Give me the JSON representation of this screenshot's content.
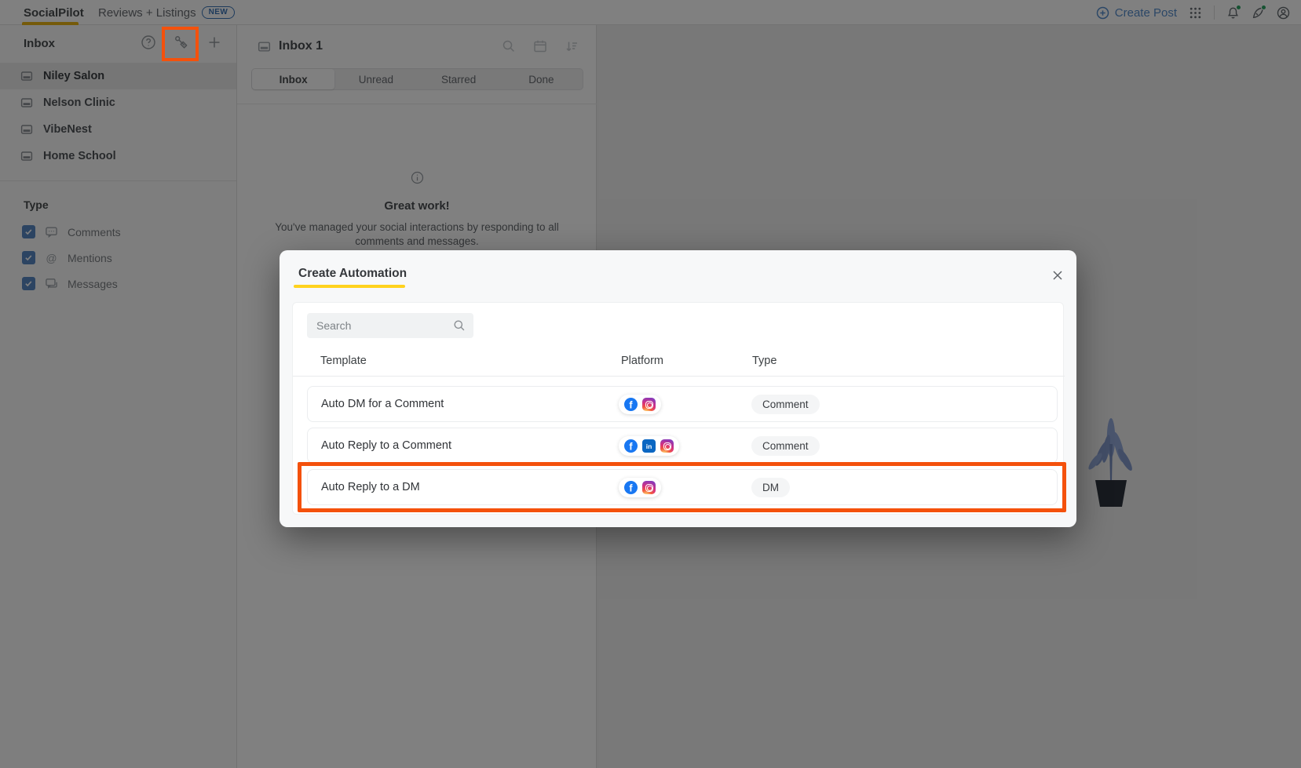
{
  "topbar": {
    "brand": "SocialPilot",
    "reviews_listings": "Reviews + Listings",
    "new_badge": "NEW",
    "create_post": "Create Post"
  },
  "sidebar": {
    "title": "Inbox",
    "accounts": [
      {
        "name": "Niley Salon",
        "selected": true
      },
      {
        "name": "Nelson Clinic",
        "selected": false
      },
      {
        "name": "VibeNest",
        "selected": false
      },
      {
        "name": "Home School",
        "selected": false
      }
    ],
    "type": {
      "title": "Type",
      "filters": [
        {
          "label": "Comments",
          "checked": true
        },
        {
          "label": "Mentions",
          "checked": true
        },
        {
          "label": "Messages",
          "checked": true
        }
      ]
    }
  },
  "inbox_panel": {
    "title": "Inbox 1",
    "tabs": [
      {
        "label": "Inbox",
        "active": true
      },
      {
        "label": "Unread",
        "active": false
      },
      {
        "label": "Starred",
        "active": false
      },
      {
        "label": "Done",
        "active": false
      }
    ],
    "empty_state": {
      "title": "Great work!",
      "description": "You've managed your social interactions by responding to all comments and messages."
    }
  },
  "modal": {
    "title": "Create Automation",
    "search_placeholder": "Search",
    "columns": {
      "template": "Template",
      "platform": "Platform",
      "type": "Type"
    },
    "rows": [
      {
        "template": "Auto DM for a Comment",
        "platforms": [
          "facebook",
          "instagram"
        ],
        "type": "Comment",
        "highlighted": false
      },
      {
        "template": "Auto Reply to a Comment",
        "platforms": [
          "facebook",
          "linkedin",
          "instagram"
        ],
        "type": "Comment",
        "highlighted": false
      },
      {
        "template": "Auto Reply to a DM",
        "platforms": [
          "facebook",
          "instagram"
        ],
        "type": "DM",
        "highlighted": true
      }
    ]
  },
  "icon_glyphs": {
    "facebook": "f",
    "linkedin": "in",
    "mention": "@"
  },
  "colors": {
    "annotation_orange": "#f4510c",
    "brand_yellow": "#ffd21e",
    "tab_gold": "#e7af06",
    "facebook_blue": "#1877f2",
    "linkedin_blue": "#0a66c2",
    "checkbox_blue": "#4d80c0",
    "create_post_blue": "#4c86c9"
  }
}
